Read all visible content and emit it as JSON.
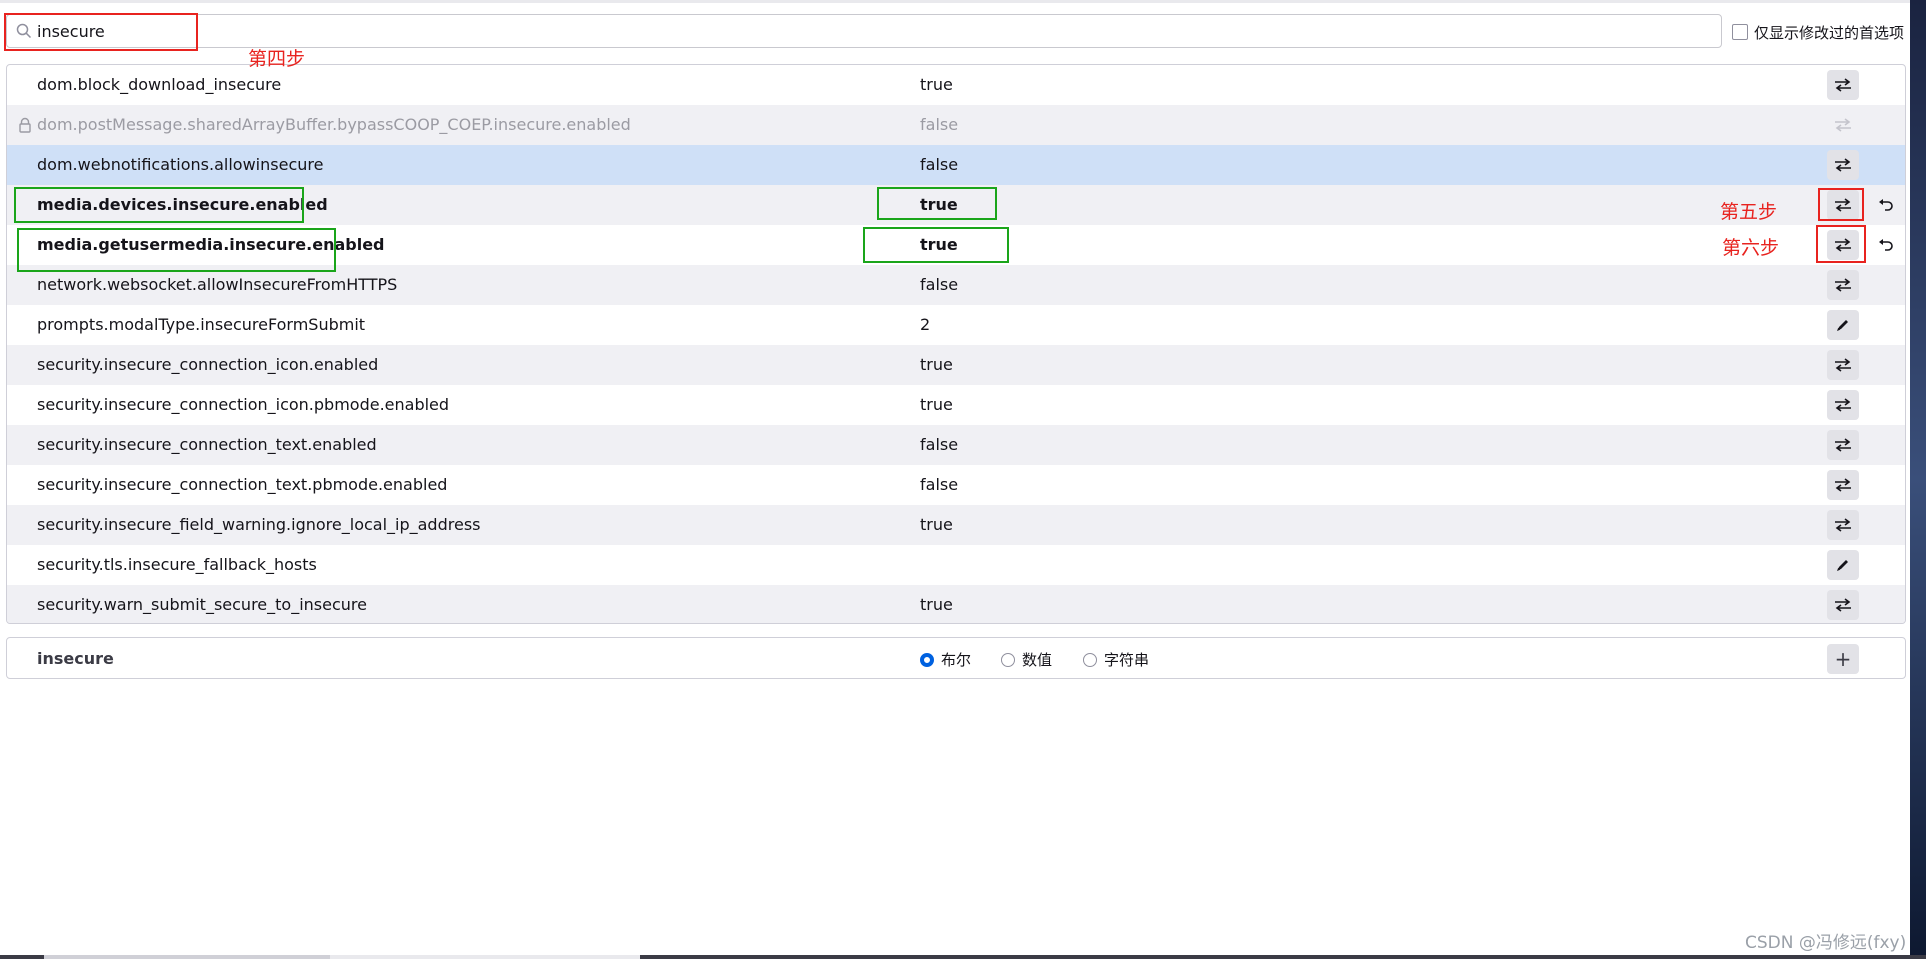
{
  "search": {
    "value": "insecure"
  },
  "modified_only": {
    "label": "仅显示修改过的首选项",
    "checked": false
  },
  "prefs": [
    {
      "name": "dom.block_download_insecure",
      "value": "true",
      "action": "toggle"
    },
    {
      "name": "dom.postMessage.sharedArrayBuffer.bypassCOOP_COEP.insecure.enabled",
      "value": "false",
      "action": "toggle",
      "locked": true
    },
    {
      "name": "dom.webnotifications.allowinsecure",
      "value": "false",
      "action": "toggle",
      "selected": true
    },
    {
      "name": "media.devices.insecure.enabled",
      "value": "true",
      "action": "toggle",
      "modified": true
    },
    {
      "name": "media.getusermedia.insecure.enabled",
      "value": "true",
      "action": "toggle",
      "modified": true
    },
    {
      "name": "network.websocket.allowInsecureFromHTTPS",
      "value": "false",
      "action": "toggle"
    },
    {
      "name": "prompts.modalType.insecureFormSubmit",
      "value": "2",
      "action": "edit"
    },
    {
      "name": "security.insecure_connection_icon.enabled",
      "value": "true",
      "action": "toggle"
    },
    {
      "name": "security.insecure_connection_icon.pbmode.enabled",
      "value": "true",
      "action": "toggle"
    },
    {
      "name": "security.insecure_connection_text.enabled",
      "value": "false",
      "action": "toggle"
    },
    {
      "name": "security.insecure_connection_text.pbmode.enabled",
      "value": "false",
      "action": "toggle"
    },
    {
      "name": "security.insecure_field_warning.ignore_local_ip_address",
      "value": "true",
      "action": "toggle"
    },
    {
      "name": "security.tls.insecure_fallback_hosts",
      "value": "",
      "action": "edit"
    },
    {
      "name": "security.warn_submit_secure_to_insecure",
      "value": "true",
      "action": "toggle"
    }
  ],
  "add_pref": {
    "name": "insecure",
    "types": [
      {
        "label": "布尔",
        "selected": true
      },
      {
        "label": "数值",
        "selected": false
      },
      {
        "label": "字符串",
        "selected": false
      }
    ],
    "add_label": "+"
  },
  "annotations": {
    "step4": "第四步",
    "step5": "第五步",
    "step6": "第六步"
  },
  "watermark": "CSDN @冯修远(fxy)",
  "colors": {
    "accent": "#0061e0",
    "annotation_red": "#e8231f",
    "annotation_green": "#1aa51a",
    "selected_row": "#cfe0f7"
  }
}
